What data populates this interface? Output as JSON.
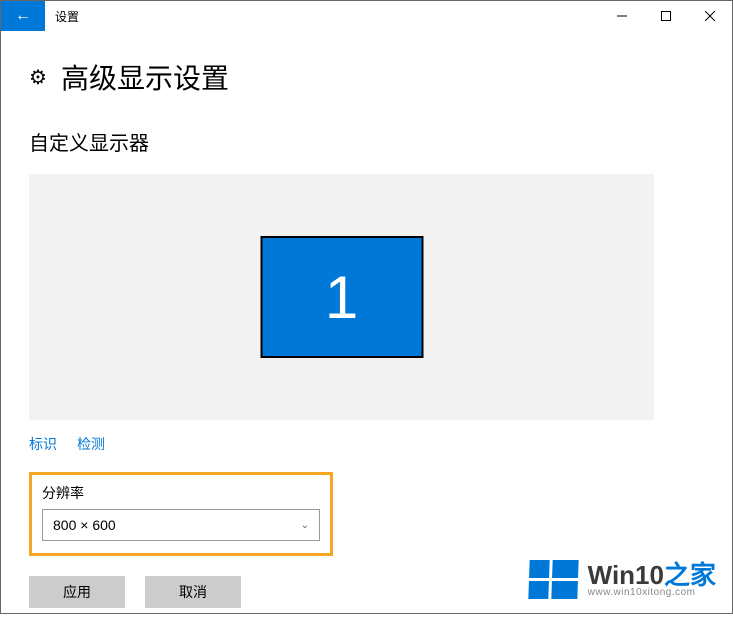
{
  "titlebar": {
    "title": "设置"
  },
  "header": {
    "page_title": "高级显示设置"
  },
  "section": {
    "customize_title": "自定义显示器",
    "monitor_number": "1"
  },
  "links": {
    "identify": "标识",
    "detect": "检测"
  },
  "resolution": {
    "label": "分辨率",
    "value": "800 × 600"
  },
  "buttons": {
    "apply": "应用",
    "cancel": "取消"
  },
  "watermark": {
    "brand_prefix": "Win10",
    "brand_suffix": "之家",
    "url": "www.win10xitong.com"
  }
}
